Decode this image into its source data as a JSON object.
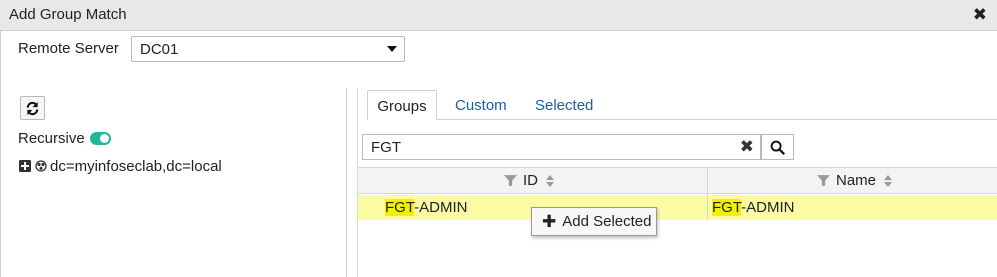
{
  "dialog": {
    "title": "Add Group Match",
    "close_icon": "close-icon"
  },
  "remote_server": {
    "label": "Remote Server",
    "value": "DC01"
  },
  "left_panel": {
    "recursive_label": "Recursive",
    "recursive_on": true,
    "tree_item": "dc=myinfoseclab,dc=local"
  },
  "tabs": [
    {
      "label": "Groups",
      "active": true
    },
    {
      "label": "Custom",
      "active": false
    },
    {
      "label": "Selected",
      "active": false
    }
  ],
  "search": {
    "value": "FGT"
  },
  "table": {
    "columns": [
      "ID",
      "Name"
    ],
    "rows": [
      {
        "id_match": "FGT",
        "id_rest": "-ADMIN",
        "name_match": "FGT",
        "name_rest": "-ADMIN"
      }
    ]
  },
  "context_button": {
    "label": "Add Selected"
  },
  "colors": {
    "accent": "#1fb89a",
    "link": "#1d5fa6",
    "row_highlight": "#fbfba4",
    "match_highlight": "#f1f100"
  }
}
